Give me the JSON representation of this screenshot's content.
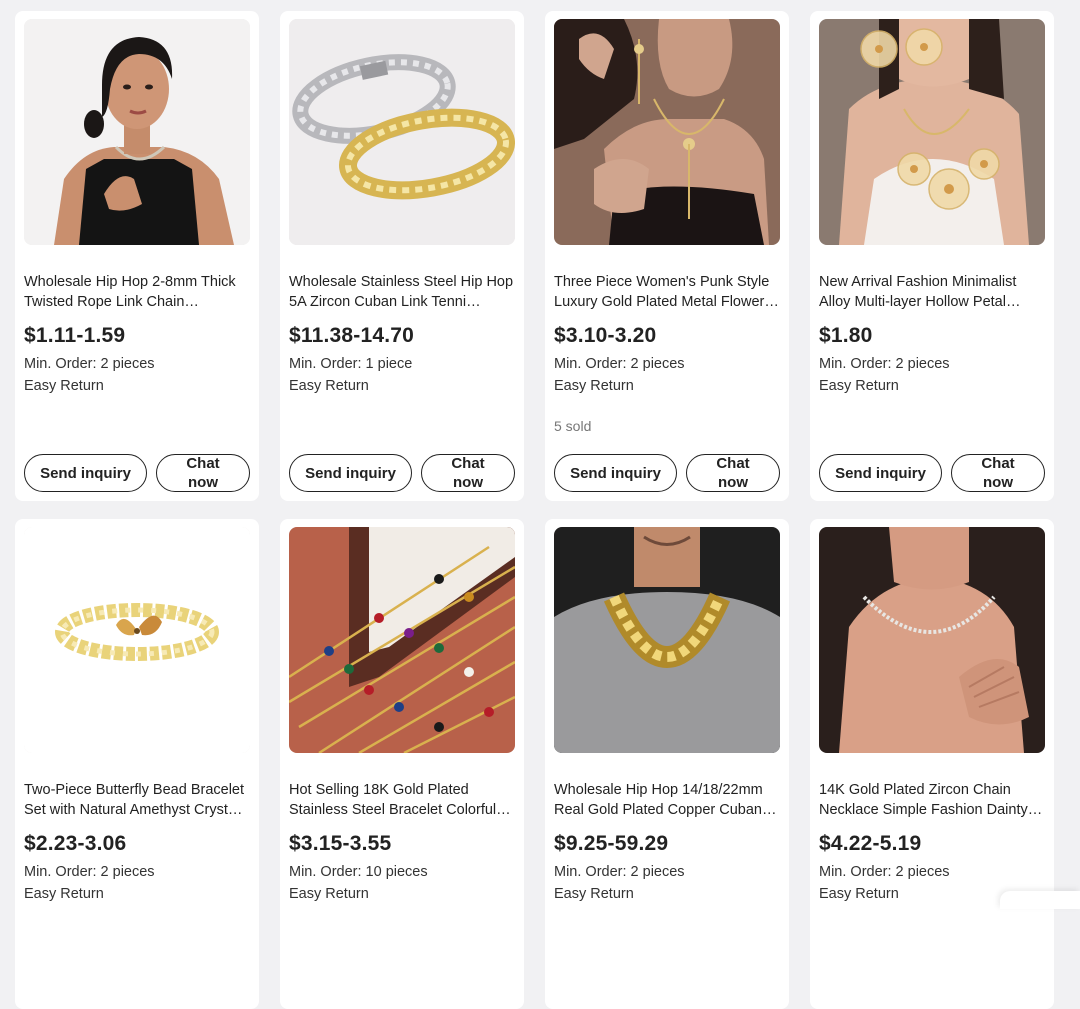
{
  "products": [
    {
      "image": "woman-twisted-rope-chain",
      "title": "Wholesale Hip Hop 2-8mm Thick Twisted Rope Link Chain…",
      "price": "$1.11-1.59",
      "moq": "Min. Order: 2 pieces",
      "return": "Easy Return",
      "sold": "",
      "inquiry_label": "Send inquiry",
      "chat_label": "Chat now"
    },
    {
      "image": "zircon-cuban-link-bracelets",
      "title": "Wholesale Stainless Steel Hip Hop 5A Zircon Cuban Link Tenni…",
      "price": "$11.38-14.70",
      "moq": "Min. Order: 1 piece",
      "return": "Easy Return",
      "sold": "",
      "inquiry_label": "Send inquiry",
      "chat_label": "Chat now"
    },
    {
      "image": "punk-style-flower-jewelry-set",
      "title": "Three Piece Women's Punk Style Luxury Gold Plated Metal Flower…",
      "price": "$3.10-3.20",
      "moq": "Min. Order: 2 pieces",
      "return": "Easy Return",
      "sold": "5 sold",
      "inquiry_label": "Send inquiry",
      "chat_label": "Chat now"
    },
    {
      "image": "hollow-petal-flower-necklace",
      "title": "New Arrival Fashion Minimalist Alloy Multi-layer Hollow Petal…",
      "price": "$1.80",
      "moq": "Min. Order: 2 pieces",
      "return": "Easy Return",
      "sold": "",
      "inquiry_label": "Send inquiry",
      "chat_label": "Chat now"
    },
    {
      "image": "butterfly-bead-bracelet",
      "title": "Two-Piece Butterfly Bead Bracelet Set with Natural Amethyst Cryst…",
      "price": "$2.23-3.06",
      "moq": "Min. Order: 2 pieces",
      "return": "Easy Return"
    },
    {
      "image": "colorful-gold-bracelets",
      "title": "Hot Selling 18K Gold Plated Stainless Steel Bracelet Colorful…",
      "price": "$3.15-3.55",
      "moq": "Min. Order: 10 pieces",
      "return": "Easy Return"
    },
    {
      "image": "gold-cuban-chain-man",
      "title": "Wholesale Hip Hop 14/18/22mm Real Gold Plated Copper Cuban…",
      "price": "$9.25-59.29",
      "moq": "Min. Order: 2 pieces",
      "return": "Easy Return"
    },
    {
      "image": "zircon-chain-necklace-woman",
      "title": "14K Gold Plated Zircon Chain Necklace Simple Fashion Dainty…",
      "price": "$4.22-5.19",
      "moq": "Min. Order: 2 pieces",
      "return": "Easy Return"
    }
  ]
}
